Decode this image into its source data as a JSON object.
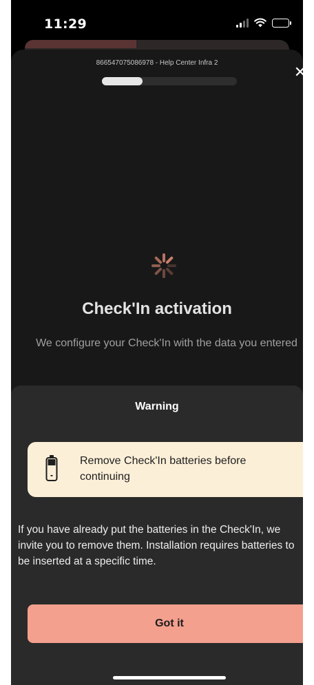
{
  "status_bar": {
    "time": "11:29",
    "signal_icon": "cellular-signal-icon",
    "wifi_icon": "wifi-icon",
    "battery_icon": "battery-icon"
  },
  "header": {
    "title": "866547075086978 - Help Center Infra 2",
    "progress": 0.3,
    "close_icon": "close-icon"
  },
  "main": {
    "spinner_icon": "loading-spinner-icon",
    "title": "Check'In activation",
    "subtitle": "We configure your Check'In with the data you entered"
  },
  "sheet": {
    "title": "Warning",
    "alert": {
      "icon": "battery-warning-icon",
      "text": "Remove Check'In batteries before continuing"
    },
    "body": "If you have already put the batteries in the Check'In, we invite you to remove them. Installation requires batteries to be inserted at a specific time.",
    "button_label": "Got it"
  },
  "colors": {
    "accent_button": "#f3a08e",
    "alert_background": "#fcefd8",
    "spinner": "#d4836f",
    "modal_background": "#181818",
    "sheet_background": "#2a2a2a"
  }
}
